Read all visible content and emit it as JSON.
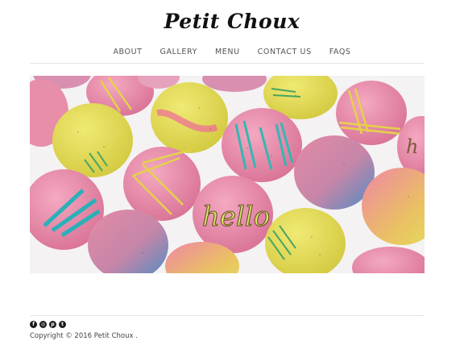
{
  "site": {
    "title": "Petit Choux"
  },
  "nav": {
    "items": [
      {
        "label": "ABOUT",
        "name": "nav-about"
      },
      {
        "label": "GALLERY",
        "name": "nav-gallery"
      },
      {
        "label": "MENU",
        "name": "nav-menu"
      },
      {
        "label": "CONTACT US",
        "name": "nav-contact-us"
      },
      {
        "label": "FAQS",
        "name": "nav-faqs"
      }
    ]
  },
  "hero": {
    "macaron_lettering": "hello",
    "colors": {
      "pink": "#e98aa9",
      "yellow": "#e4de5a",
      "blue": "#5b8fc0",
      "background": "#f4f2f3"
    }
  },
  "footer": {
    "social_icons": [
      {
        "name": "facebook-icon",
        "glyph": "f"
      },
      {
        "name": "instagram-icon",
        "glyph": "◎"
      },
      {
        "name": "pinterest-icon",
        "glyph": "p"
      },
      {
        "name": "twitter-icon",
        "glyph": "t"
      }
    ],
    "copyright_prefix": "Copyright © 2016",
    "copyright_link": "Petit Choux",
    "copyright_suffix": "."
  }
}
